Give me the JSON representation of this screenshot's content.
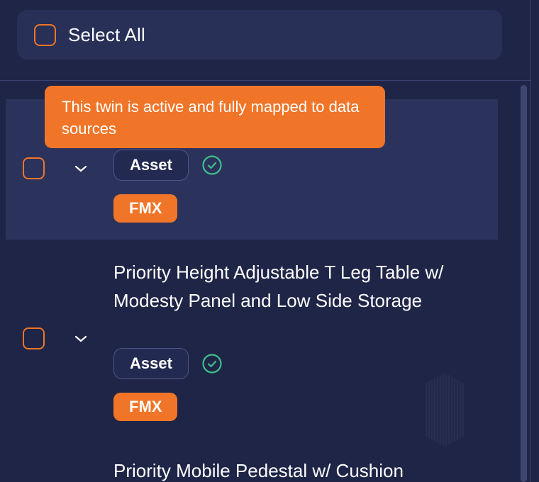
{
  "header": {
    "select_all_label": "Select All"
  },
  "tooltip": {
    "text": "This twin is active and fully mapped to data sources"
  },
  "items": [
    {
      "title": "",
      "type": "Asset",
      "status": "active",
      "source": "FMX",
      "highlighted": true
    },
    {
      "title": "Priority Height Adjustable T Leg Table w/ Modesty Panel and Low Side Storage",
      "type": "Asset",
      "status": "active",
      "source": "FMX",
      "highlighted": false
    },
    {
      "title": "Priority Mobile Pedestal w/ Cushion"
    }
  ],
  "colors": {
    "background": "#1f2547",
    "accent": "#f07528",
    "status_ok": "#3fbf8a",
    "highlight_row": "#2b335c"
  },
  "icons": {
    "chevron": "chevron-down-icon",
    "status": "check-circle-icon"
  }
}
